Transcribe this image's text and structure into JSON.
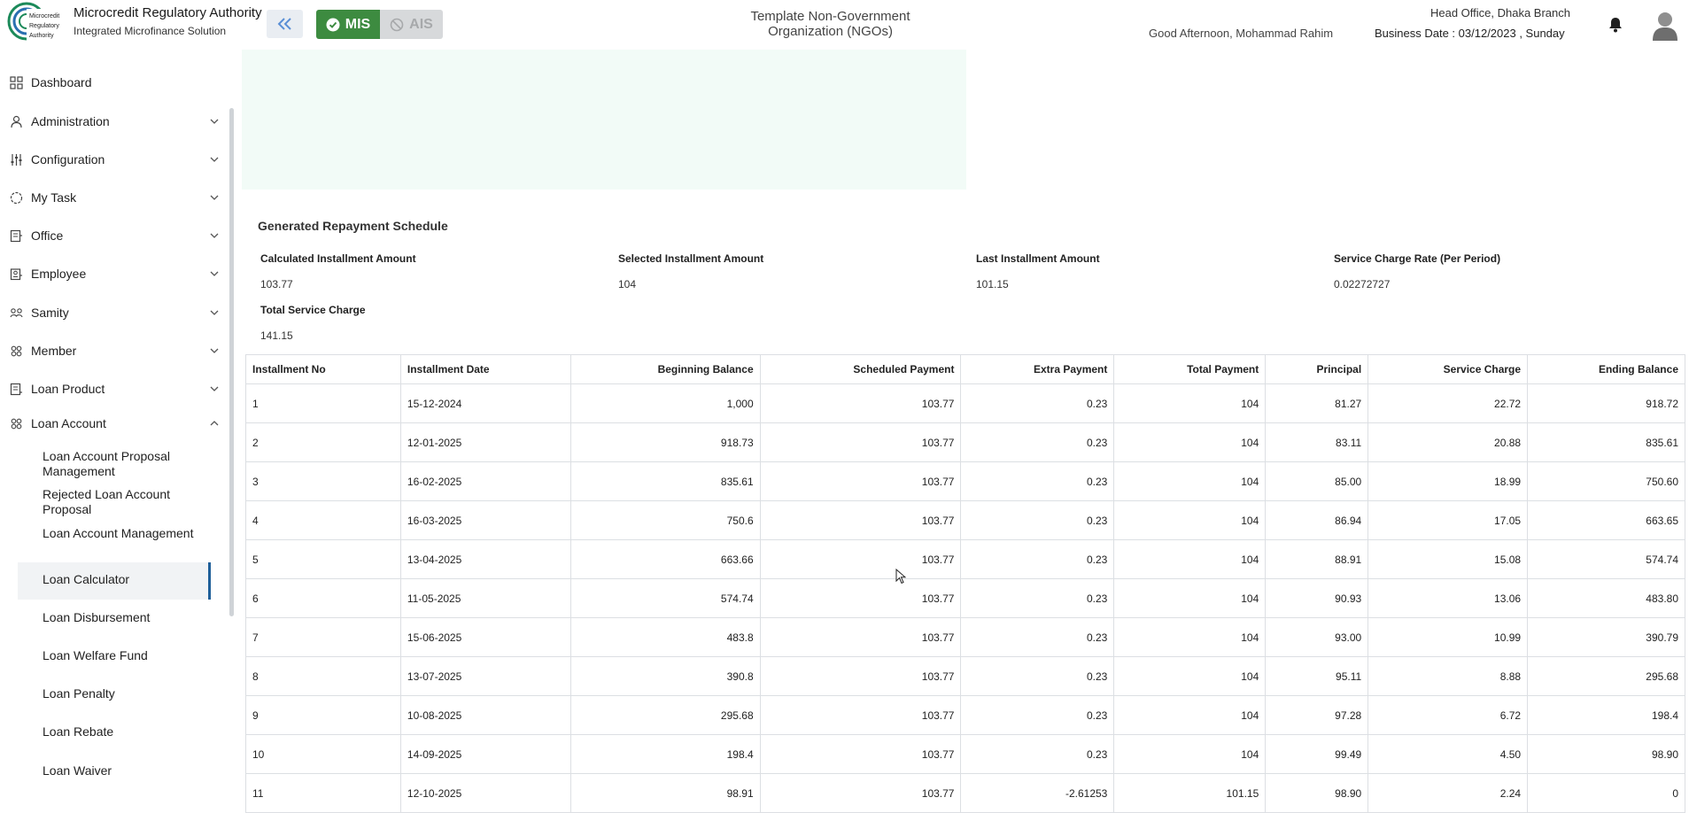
{
  "header": {
    "brand_title": "Microcredit Regulatory Authority",
    "brand_subtitle": "Integrated Microfinance Solution",
    "logo_text": [
      "Microcredit",
      "Regulatory",
      "Authority"
    ],
    "mis_label": "MIS",
    "ais_label": "AIS",
    "org_name": "Template Non-Government Organization (NGOs)",
    "greeting": "Good Afternoon, Mohammad Rahim",
    "branch": "Head Office, Dhaka Branch",
    "business_date": "Business Date : 03/12/2023 , Sunday",
    "colors": {
      "mis": "#3d8b40",
      "ais": "#d7d9db",
      "accent": "#1f5f99"
    }
  },
  "sidebar": {
    "items": [
      {
        "label": "Dashboard",
        "icon": "grid-icon"
      },
      {
        "label": "Administration",
        "icon": "admin-icon"
      },
      {
        "label": "Configuration",
        "icon": "sliders-icon"
      },
      {
        "label": "My Task",
        "icon": "task-icon"
      },
      {
        "label": "Office",
        "icon": "office-icon"
      },
      {
        "label": "Employee",
        "icon": "employee-icon"
      },
      {
        "label": "Samity",
        "icon": "samity-icon"
      },
      {
        "label": "Member",
        "icon": "member-icon"
      },
      {
        "label": "Loan Product",
        "icon": "loan-product-icon"
      },
      {
        "label": "Loan Account",
        "icon": "loan-account-icon"
      }
    ],
    "sub_items": [
      "Loan Account Proposal Management",
      "Rejected Loan Account Proposal",
      "Loan Account Management",
      "Loan Calculator",
      "Loan Disbursement",
      "Loan Welfare Fund",
      "Loan Penalty",
      "Loan Rebate",
      "Loan Waiver"
    ],
    "active_sub_item": "Loan Calculator"
  },
  "schedule": {
    "title": "Generated Repayment Schedule",
    "summary": {
      "calc_label": "Calculated Installment Amount",
      "calc_value": "103.77",
      "selected_label": "Selected Installment Amount",
      "selected_value": "104",
      "last_label": "Last Installment Amount",
      "last_value": "101.15",
      "rate_label": "Service Charge Rate (Per Period)",
      "rate_value": "0.02272727",
      "total_sc_label": "Total Service Charge",
      "total_sc_value": "141.15"
    },
    "columns": [
      "Installment No",
      "Installment Date",
      "Beginning Balance",
      "Scheduled Payment",
      "Extra Payment",
      "Total Payment",
      "Principal",
      "Service Charge",
      "Ending Balance"
    ],
    "rows": [
      [
        "1",
        "15-12-2024",
        "1,000",
        "103.77",
        "0.23",
        "104",
        "81.27",
        "22.72",
        "918.72"
      ],
      [
        "2",
        "12-01-2025",
        "918.73",
        "103.77",
        "0.23",
        "104",
        "83.11",
        "20.88",
        "835.61"
      ],
      [
        "3",
        "16-02-2025",
        "835.61",
        "103.77",
        "0.23",
        "104",
        "85.00",
        "18.99",
        "750.60"
      ],
      [
        "4",
        "16-03-2025",
        "750.6",
        "103.77",
        "0.23",
        "104",
        "86.94",
        "17.05",
        "663.65"
      ],
      [
        "5",
        "13-04-2025",
        "663.66",
        "103.77",
        "0.23",
        "104",
        "88.91",
        "15.08",
        "574.74"
      ],
      [
        "6",
        "11-05-2025",
        "574.74",
        "103.77",
        "0.23",
        "104",
        "90.93",
        "13.06",
        "483.80"
      ],
      [
        "7",
        "15-06-2025",
        "483.8",
        "103.77",
        "0.23",
        "104",
        "93.00",
        "10.99",
        "390.79"
      ],
      [
        "8",
        "13-07-2025",
        "390.8",
        "103.77",
        "0.23",
        "104",
        "95.11",
        "8.88",
        "295.68"
      ],
      [
        "9",
        "10-08-2025",
        "295.68",
        "103.77",
        "0.23",
        "104",
        "97.28",
        "6.72",
        "198.4"
      ],
      [
        "10",
        "14-09-2025",
        "198.4",
        "103.77",
        "0.23",
        "104",
        "99.49",
        "4.50",
        "98.90"
      ],
      [
        "11",
        "12-10-2025",
        "98.91",
        "103.77",
        "-2.61253",
        "101.15",
        "98.90",
        "2.24",
        "0"
      ]
    ]
  }
}
